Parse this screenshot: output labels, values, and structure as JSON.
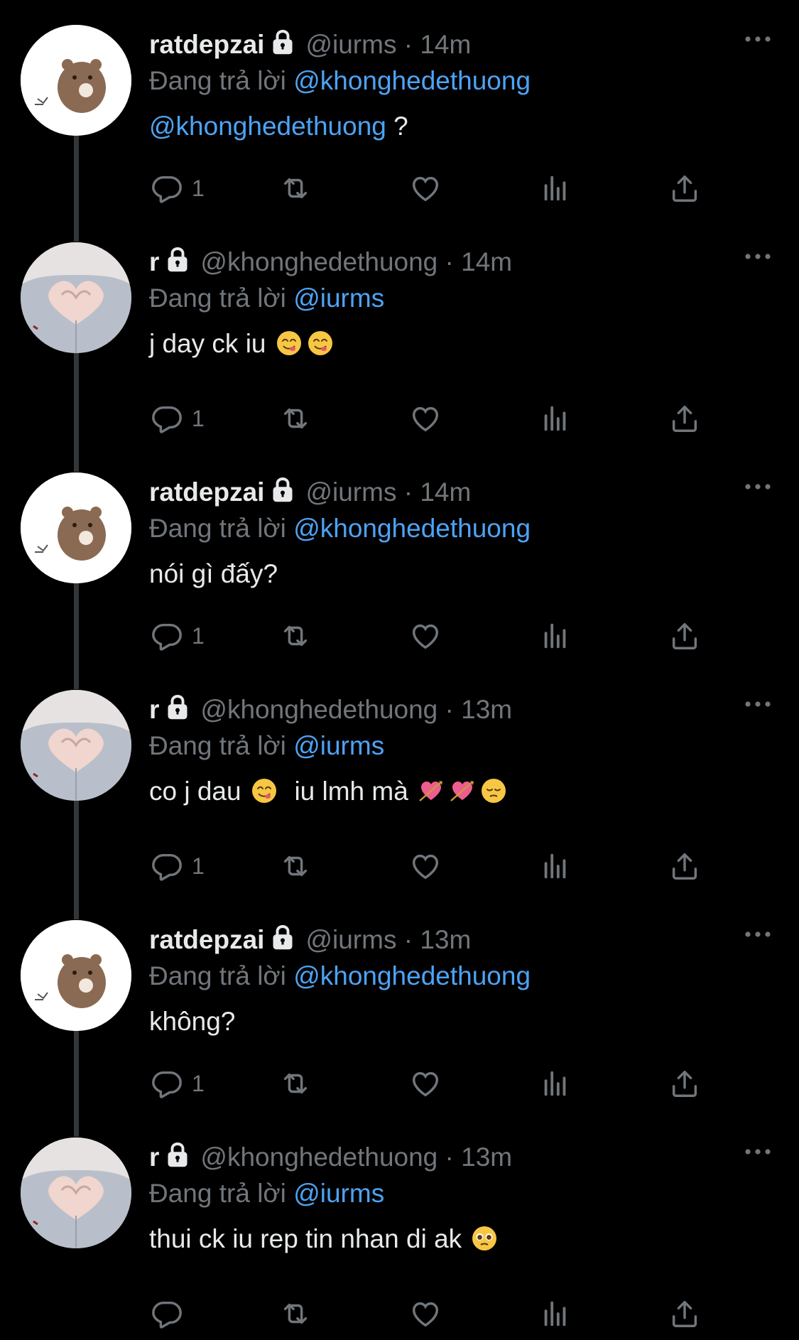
{
  "colors": {
    "background": "#000000",
    "link": "#4da3f5",
    "muted": "#71767b",
    "text": "#e7e9ea"
  },
  "reply_prefix": "Đang trả lời",
  "tweets": [
    {
      "name": "ratdepzai",
      "handle": "@iurms",
      "time": "14m",
      "reply_to": "@khonghedethuong",
      "text_mention": "@khonghedethuong",
      "text": " ?",
      "reply_count": "1",
      "avatar": "bear"
    },
    {
      "name": "r",
      "handle": "@khonghedethuong",
      "time": "14m",
      "reply_to": "@iurms",
      "text": "j day ck iu",
      "emojis": [
        "yum-emoji",
        "yum-emoji"
      ],
      "reply_count": "1",
      "avatar": "hands"
    },
    {
      "name": "ratdepzai",
      "handle": "@iurms",
      "time": "14m",
      "reply_to": "@khonghedethuong",
      "text": "nói gì đấy?",
      "reply_count": "1",
      "avatar": "bear"
    },
    {
      "name": "r",
      "handle": "@khonghedethuong",
      "time": "13m",
      "reply_to": "@iurms",
      "text_a": "co j dau",
      "text_b": "iu lmh mà",
      "emojis": [
        "yum-emoji",
        "heart-arrow-emoji",
        "heart-arrow-emoji",
        "pensive-emoji"
      ],
      "reply_count": "1",
      "avatar": "hands"
    },
    {
      "name": "ratdepzai",
      "handle": "@iurms",
      "time": "13m",
      "reply_to": "@khonghedethuong",
      "text": "không?",
      "reply_count": "1",
      "avatar": "bear"
    },
    {
      "name": "r",
      "handle": "@khonghedethuong",
      "time": "13m",
      "reply_to": "@iurms",
      "text": "thui ck iu rep tin nhan di ak",
      "emojis": [
        "pleading-emoji"
      ],
      "reply_count": "",
      "avatar": "hands"
    }
  ]
}
